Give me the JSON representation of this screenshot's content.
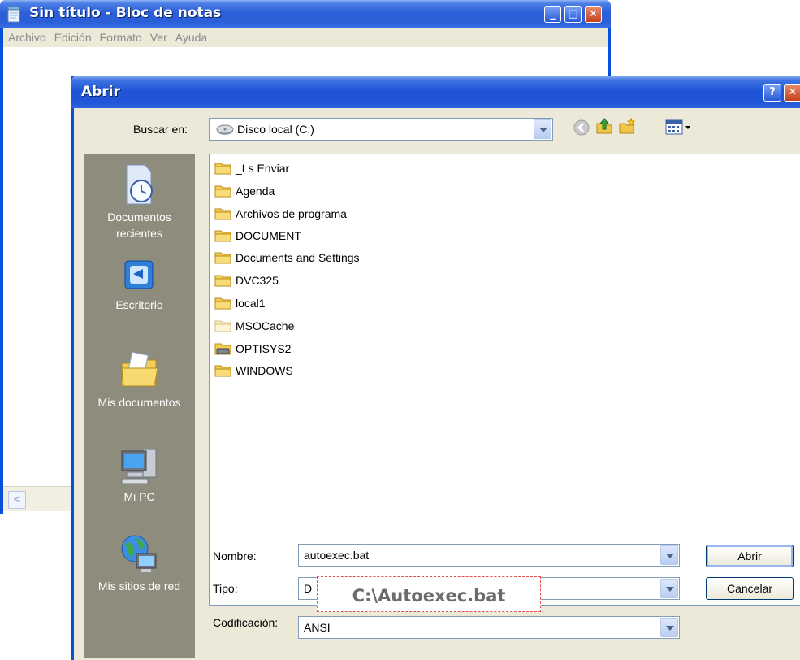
{
  "notepad": {
    "title": "Sin título - Bloc de notas",
    "menu": [
      "Archivo",
      "Edición",
      "Formato",
      "Ver",
      "Ayuda"
    ],
    "caption_buttons": {
      "minimize": "_",
      "maximize": "□",
      "close": "✕"
    }
  },
  "dialog": {
    "title": "Abrir",
    "help_button": "?",
    "close_button": "✕",
    "look_in_label": "Buscar en:",
    "look_in_value": "Disco local (C:)",
    "places": [
      {
        "label_line1": "Documentos",
        "label_line2": "recientes",
        "icon": "recent-documents-icon"
      },
      {
        "label_line1": "Escritorio",
        "label_line2": "",
        "icon": "desktop-icon"
      },
      {
        "label_line1": "Mis documentos",
        "label_line2": "",
        "icon": "my-documents-icon"
      },
      {
        "label_line1": "Mi PC",
        "label_line2": "",
        "icon": "my-computer-icon"
      },
      {
        "label_line1": "Mis sitios de red",
        "label_line2": "",
        "icon": "network-places-icon"
      }
    ],
    "files": [
      {
        "name": "_Ls Enviar",
        "icon": "folder-icon"
      },
      {
        "name": "Agenda",
        "icon": "folder-icon"
      },
      {
        "name": "Archivos de programa",
        "icon": "folder-icon"
      },
      {
        "name": "DOCUMENT",
        "icon": "folder-icon"
      },
      {
        "name": "Documents and Settings",
        "icon": "folder-icon"
      },
      {
        "name": "DVC325",
        "icon": "folder-icon"
      },
      {
        "name": "local1",
        "icon": "folder-icon"
      },
      {
        "name": "MSOCache",
        "icon": "hidden-folder-icon"
      },
      {
        "name": "OPTISYS2",
        "icon": "drive-folder-icon"
      },
      {
        "name": "WINDOWS",
        "icon": "folder-icon"
      }
    ],
    "filename_label": "Nombre:",
    "filename_value": "autoexec.bat",
    "type_label": "Tipo:",
    "type_value": "D",
    "encoding_label": "Codificación:",
    "encoding_value": "ANSI",
    "open_button": "Abrir",
    "cancel_button": "Cancelar"
  },
  "callout": "C:\\Autoexec.bat",
  "colors": {
    "titlebar": "#2a5fd8",
    "dialog_bg": "#ece9d8",
    "places_bar": "#8e8c7d",
    "callout_border": "#e05050"
  }
}
